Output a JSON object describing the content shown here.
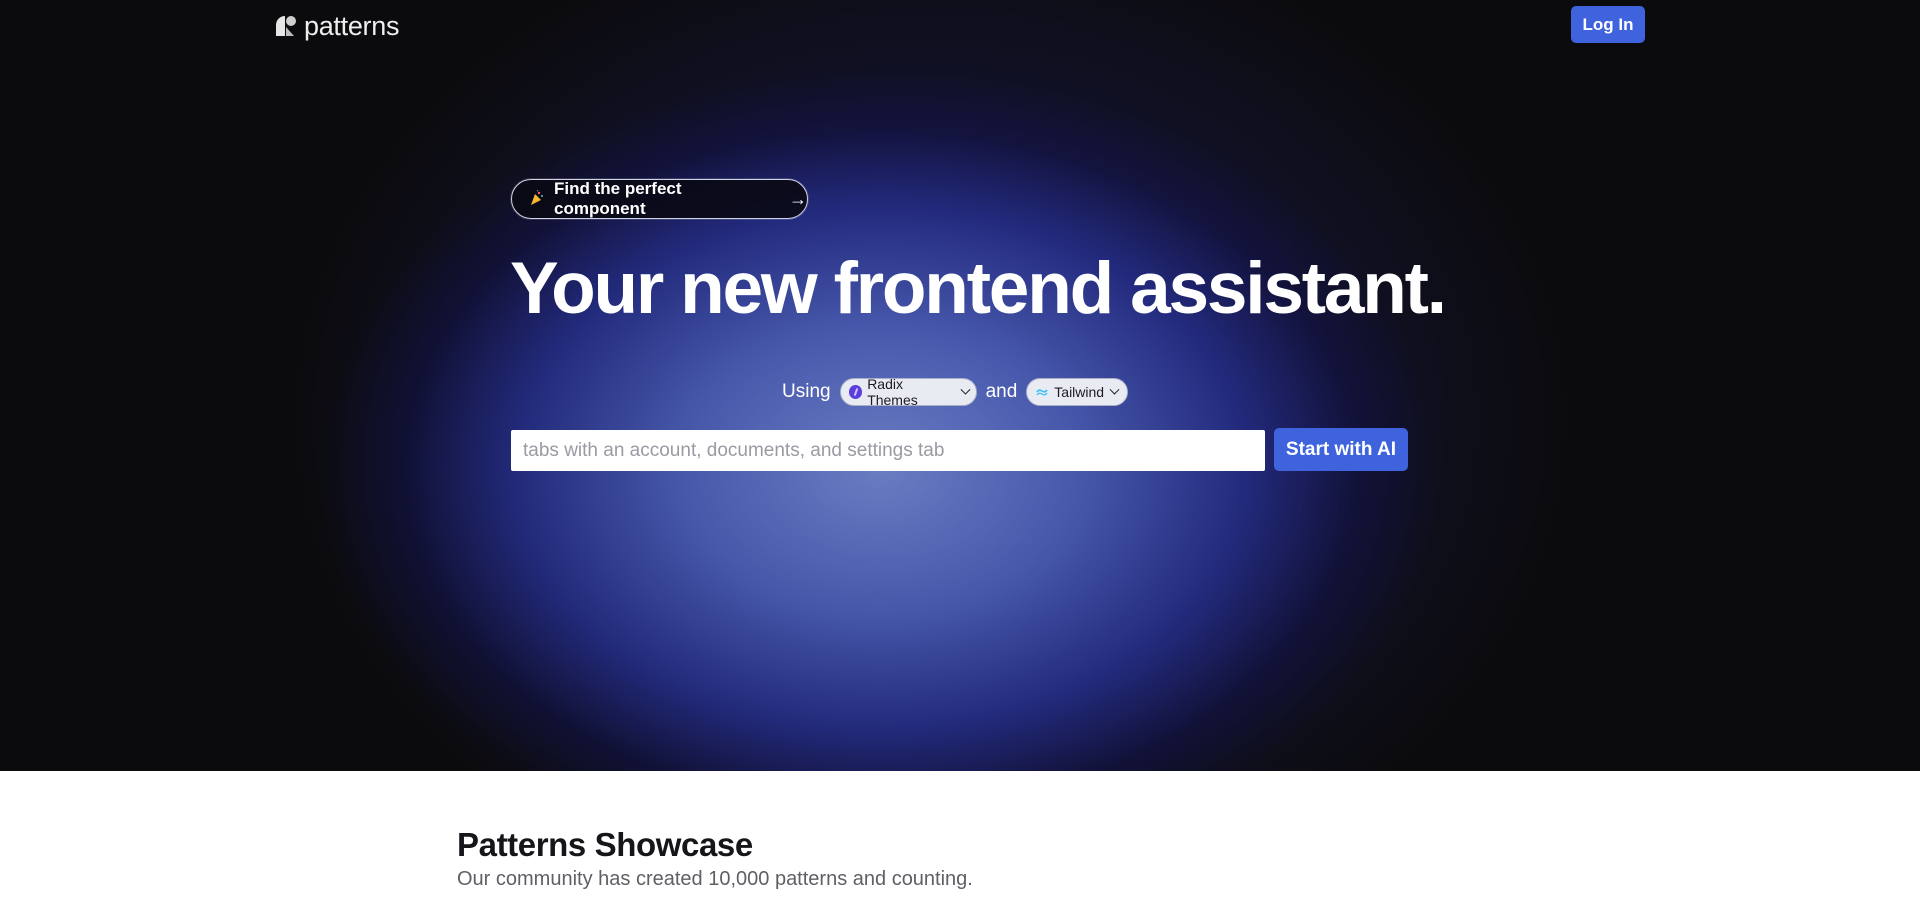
{
  "nav": {
    "logo_text": "patterns",
    "login_label": "Log In"
  },
  "hero": {
    "announcement": "Find the perfect component",
    "announcement_icon": "party-popper-icon",
    "headline": "Your new frontend assistant.",
    "using_label": "Using",
    "and_label": "and",
    "library_select": {
      "value": "Radix Themes",
      "icon": "radix-icon"
    },
    "css_select": {
      "value": "Tailwind",
      "icon": "tailwind-icon"
    },
    "search": {
      "placeholder": "tabs with an account, documents, and settings tab",
      "value": ""
    },
    "start_label": "Start with AI"
  },
  "showcase": {
    "title": "Patterns Showcase",
    "subtitle": "Our community has created 10,000 patterns and counting."
  },
  "colors": {
    "accent": "#3e63dd",
    "hero_bg": "#0b0b0d",
    "radix_purple": "#5b3ee0",
    "tailwind_cyan": "#38bdf8"
  }
}
